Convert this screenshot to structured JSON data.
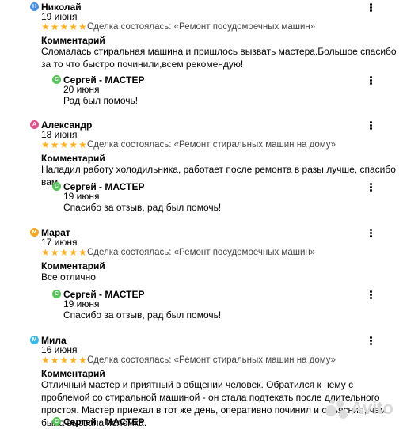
{
  "reviews": [
    {
      "author": "Николай",
      "avatar_letter": "Н",
      "avatar_color": "#4a90e2",
      "date": "19 июня",
      "stars": "★★★★★",
      "deal": "Сделка состоялась: «Ремонт посудомоечных машин»",
      "comment_title": "Комментарий",
      "comment": "Сломалась стиральная машина и пришлось вызвать мастера.Большое спасибо за то что быстро починили,всем рекомендую!",
      "reply": {
        "author": "Сергей - МАСТЕР",
        "avatar_letter": "С",
        "date": "20 июня",
        "text": "Рад был помочь!"
      }
    },
    {
      "author": "Александр",
      "avatar_letter": "А",
      "avatar_color": "#e0508a",
      "date": "18 июня",
      "stars": "★★★★★",
      "deal": "Сделка состоялась: «Ремонт стиральных машин на дому»",
      "comment_title": "Комментарий",
      "comment": "Наладил работу холодильника, работает после ремонта в разы лучше, спасибо вам.",
      "reply": {
        "author": "Сергей - МАСТЕР",
        "avatar_letter": "С",
        "date": "19 июня",
        "text": "Спасибо за отзыв, рад был помочь!"
      }
    },
    {
      "author": "Марат",
      "avatar_letter": "М",
      "avatar_color": "#f5a623",
      "date": "17 июня",
      "stars": "★★★★★",
      "deal": "Сделка состоялась: «Ремонт посудомоечных машин»",
      "comment_title": "Комментарий",
      "comment": "Все отлично",
      "reply": {
        "author": "Сергей - МАСТЕР",
        "avatar_letter": "С",
        "date": "19 июня",
        "text": "Спасибо за отзыв, рад был помочь!"
      }
    },
    {
      "author": "Мила",
      "avatar_letter": "М",
      "avatar_color": "#3bb9e6",
      "date": "16 июня",
      "stars": "★★★★★",
      "deal": "Сделка состоялась: «Ремонт стиральных машин на дому»",
      "comment_title": "Комментарий",
      "comment": "Отличный мастер и приятный в общении человек. Обратился к нему с проблемой со стиральной машиной - он стала подтекать после длительного простоя. Мастер приехал в тот же день, оперативно починил и объяснил, чем была вызвана поломка.",
      "reply": {
        "author": "Сергей - МАСТЕР",
        "avatar_letter": "С"
      }
    }
  ],
  "watermark": "Avito",
  "colors": {
    "star": "#ffb021",
    "reply_avatar": "#5ac25a"
  }
}
